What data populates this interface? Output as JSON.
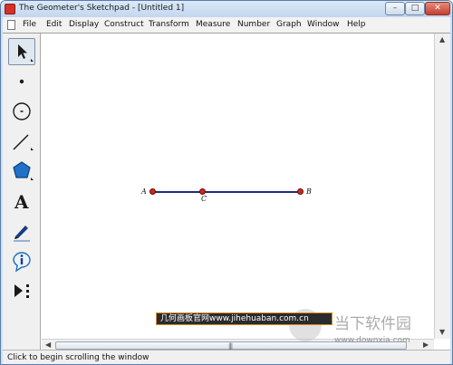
{
  "window": {
    "title": "The Geometer's Sketchpad - [Untitled 1]",
    "minimize_label": "–",
    "maximize_label": "□",
    "close_label": "✕"
  },
  "menubar": {
    "items": [
      "File",
      "Edit",
      "Display",
      "Construct",
      "Transform",
      "Measure",
      "Number",
      "Graph",
      "Window",
      "Help"
    ]
  },
  "toolbox": {
    "tools": [
      "arrow-select-icon",
      "point-icon",
      "compass-icon",
      "straightedge-icon",
      "polygon-icon",
      "text-icon",
      "marker-icon",
      "information-icon",
      "custom-tools-icon"
    ],
    "text_tool_glyph": "A"
  },
  "canvas": {
    "points": [
      {
        "label": "A",
        "color": "#d8261c"
      },
      {
        "label": "C",
        "color": "#d8261c"
      },
      {
        "label": "B",
        "color": "#d8261c"
      }
    ],
    "segment_color": "#1d2b7e"
  },
  "watermarks": {
    "site_text": "几何画板官网www.jihehuaban.com.cn",
    "logo_text": "当下软件园",
    "logo_url": "www.downxia.com"
  },
  "scrollbars": {
    "up_arrow": "▲",
    "down_arrow": "▼",
    "left_arrow": "◀",
    "right_arrow": "▶",
    "grip": "|||"
  },
  "status": {
    "text": "Click to begin scrolling the window"
  }
}
